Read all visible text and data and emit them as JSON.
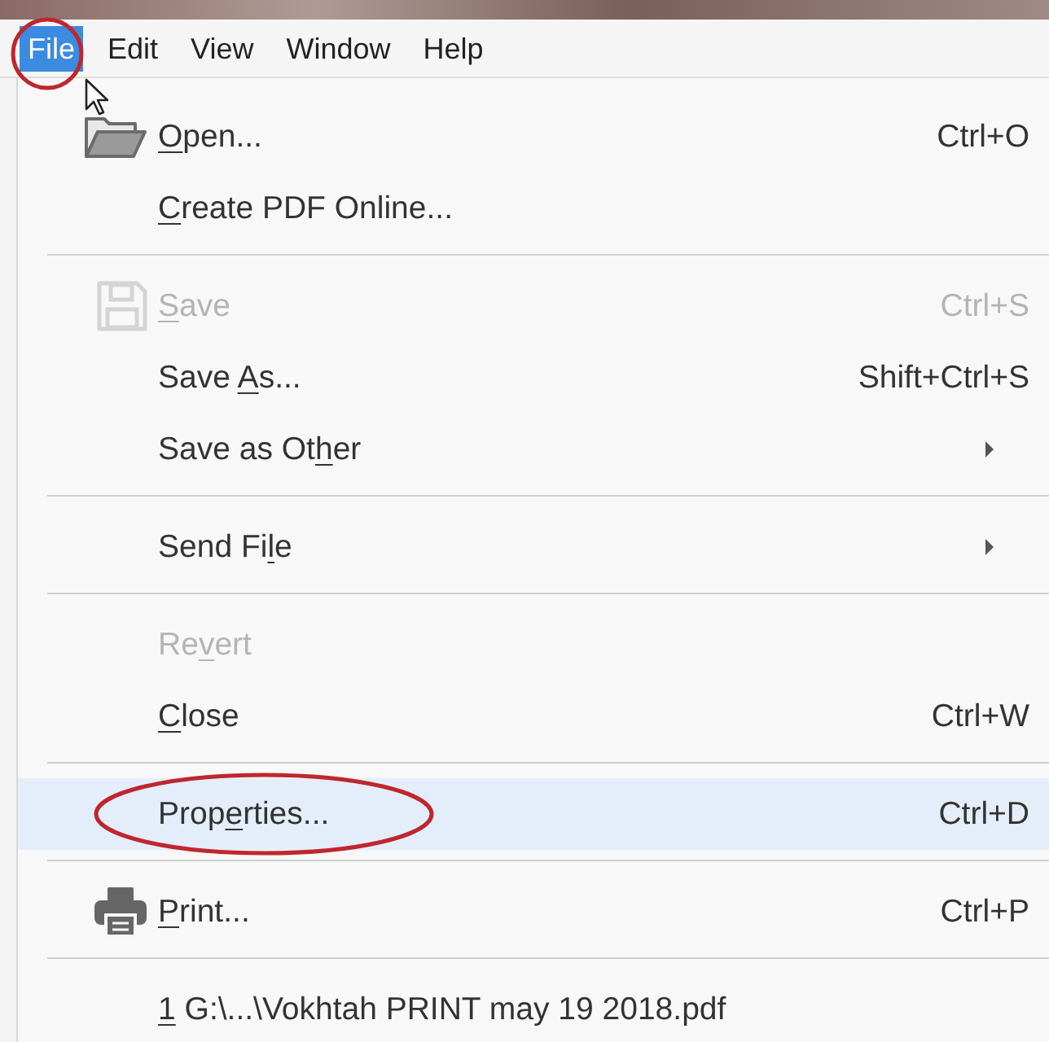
{
  "menu_bar": [
    {
      "label": "File",
      "selected": true,
      "circled": true
    },
    {
      "label": "Edit",
      "selected": false,
      "circled": false
    },
    {
      "label": "View",
      "selected": false,
      "circled": false
    },
    {
      "label": "Window",
      "selected": false,
      "circled": false
    },
    {
      "label": "Help",
      "selected": false,
      "circled": false
    }
  ],
  "file_menu": [
    {
      "kind": "item",
      "label_parts": [
        {
          "text": "O",
          "underline": true
        },
        {
          "text": "pen..."
        }
      ],
      "shortcut": "Ctrl+O",
      "disabled": false,
      "selected": false,
      "circled": false
    },
    {
      "kind": "item",
      "label_parts": [
        {
          "text": "C",
          "underline": true
        },
        {
          "text": "reate PDF Online..."
        }
      ],
      "disabled": false,
      "selected": false,
      "circled": false
    },
    {
      "kind": "separator"
    },
    {
      "kind": "item",
      "label_parts": [
        {
          "text": "S",
          "underline": true
        },
        {
          "text": "ave"
        }
      ],
      "shortcut": "Ctrl+S",
      "disabled": true,
      "selected": false,
      "circled": false
    },
    {
      "kind": "item",
      "label_parts": [
        {
          "text": "Save "
        },
        {
          "text": "A",
          "underline": true
        },
        {
          "text": "s..."
        }
      ],
      "shortcut": "Shift+Ctrl+S",
      "disabled": false,
      "selected": false,
      "circled": false
    },
    {
      "kind": "item",
      "label_parts": [
        {
          "text": "Save as Ot"
        },
        {
          "text": "h",
          "underline": true
        },
        {
          "text": "er"
        }
      ],
      "submenu": true,
      "disabled": false,
      "selected": false,
      "circled": false
    },
    {
      "kind": "separator"
    },
    {
      "kind": "item",
      "label_parts": [
        {
          "text": "Send Fi"
        },
        {
          "text": "l",
          "underline": true
        },
        {
          "text": "e"
        }
      ],
      "submenu": true,
      "disabled": false,
      "selected": false,
      "circled": false
    },
    {
      "kind": "separator"
    },
    {
      "kind": "item",
      "label_parts": [
        {
          "text": "Re"
        },
        {
          "text": "v",
          "underline": true
        },
        {
          "text": "ert"
        }
      ],
      "disabled": true,
      "selected": false,
      "circled": false
    },
    {
      "kind": "item",
      "label_parts": [
        {
          "text": "C",
          "underline": true
        },
        {
          "text": "lose"
        }
      ],
      "shortcut": "Ctrl+W",
      "disabled": false,
      "selected": false,
      "circled": false
    },
    {
      "kind": "separator"
    },
    {
      "kind": "item",
      "label_parts": [
        {
          "text": "Prop"
        },
        {
          "text": "e",
          "underline": true
        },
        {
          "text": "rties..."
        }
      ],
      "shortcut": "Ctrl+D",
      "disabled": false,
      "selected": true,
      "circled": true
    },
    {
      "kind": "separator"
    },
    {
      "kind": "item",
      "label_parts": [
        {
          "text": "P",
          "underline": true
        },
        {
          "text": "rint..."
        }
      ],
      "shortcut": "Ctrl+P",
      "disabled": false,
      "selected": false,
      "circled": false
    },
    {
      "kind": "separator"
    },
    {
      "kind": "item",
      "label_parts": [
        {
          "text": "1",
          "underline": true
        },
        {
          "text": " G:\\...\\Vokhtah PRINT may 19 2018.pdf"
        }
      ],
      "disabled": false,
      "selected": false,
      "circled": false
    }
  ]
}
